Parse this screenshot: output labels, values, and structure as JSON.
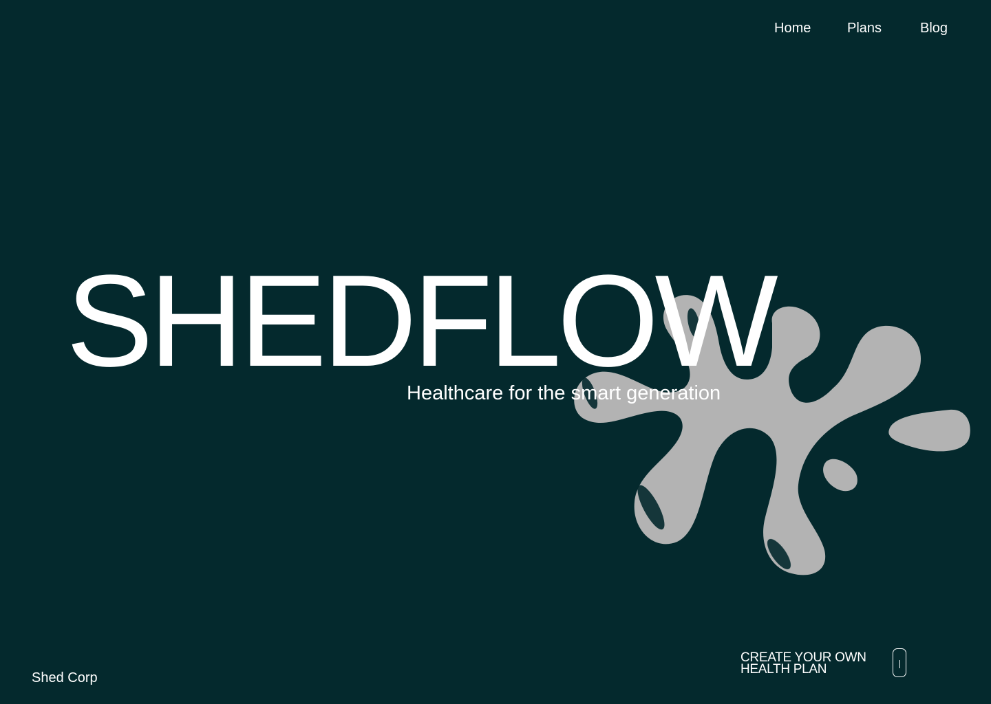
{
  "nav": {
    "items": [
      {
        "label": "Home"
      },
      {
        "label": "Plans"
      },
      {
        "label": "Blog"
      }
    ]
  },
  "hero": {
    "title": "SHEDFLOW",
    "tagline": "Healthcare for the smart generation"
  },
  "footer": {
    "brand": "Shed Corp"
  },
  "cta": {
    "line1": "CREATE YOUR OWN",
    "line2": "HEALTH PLAN",
    "icon": "scroll-indicator-icon"
  },
  "colors": {
    "background": "#04292d",
    "text": "#ffffff",
    "blob": "#b3b3b3"
  },
  "illustration": {
    "icon": "liquid-splash-shape"
  }
}
